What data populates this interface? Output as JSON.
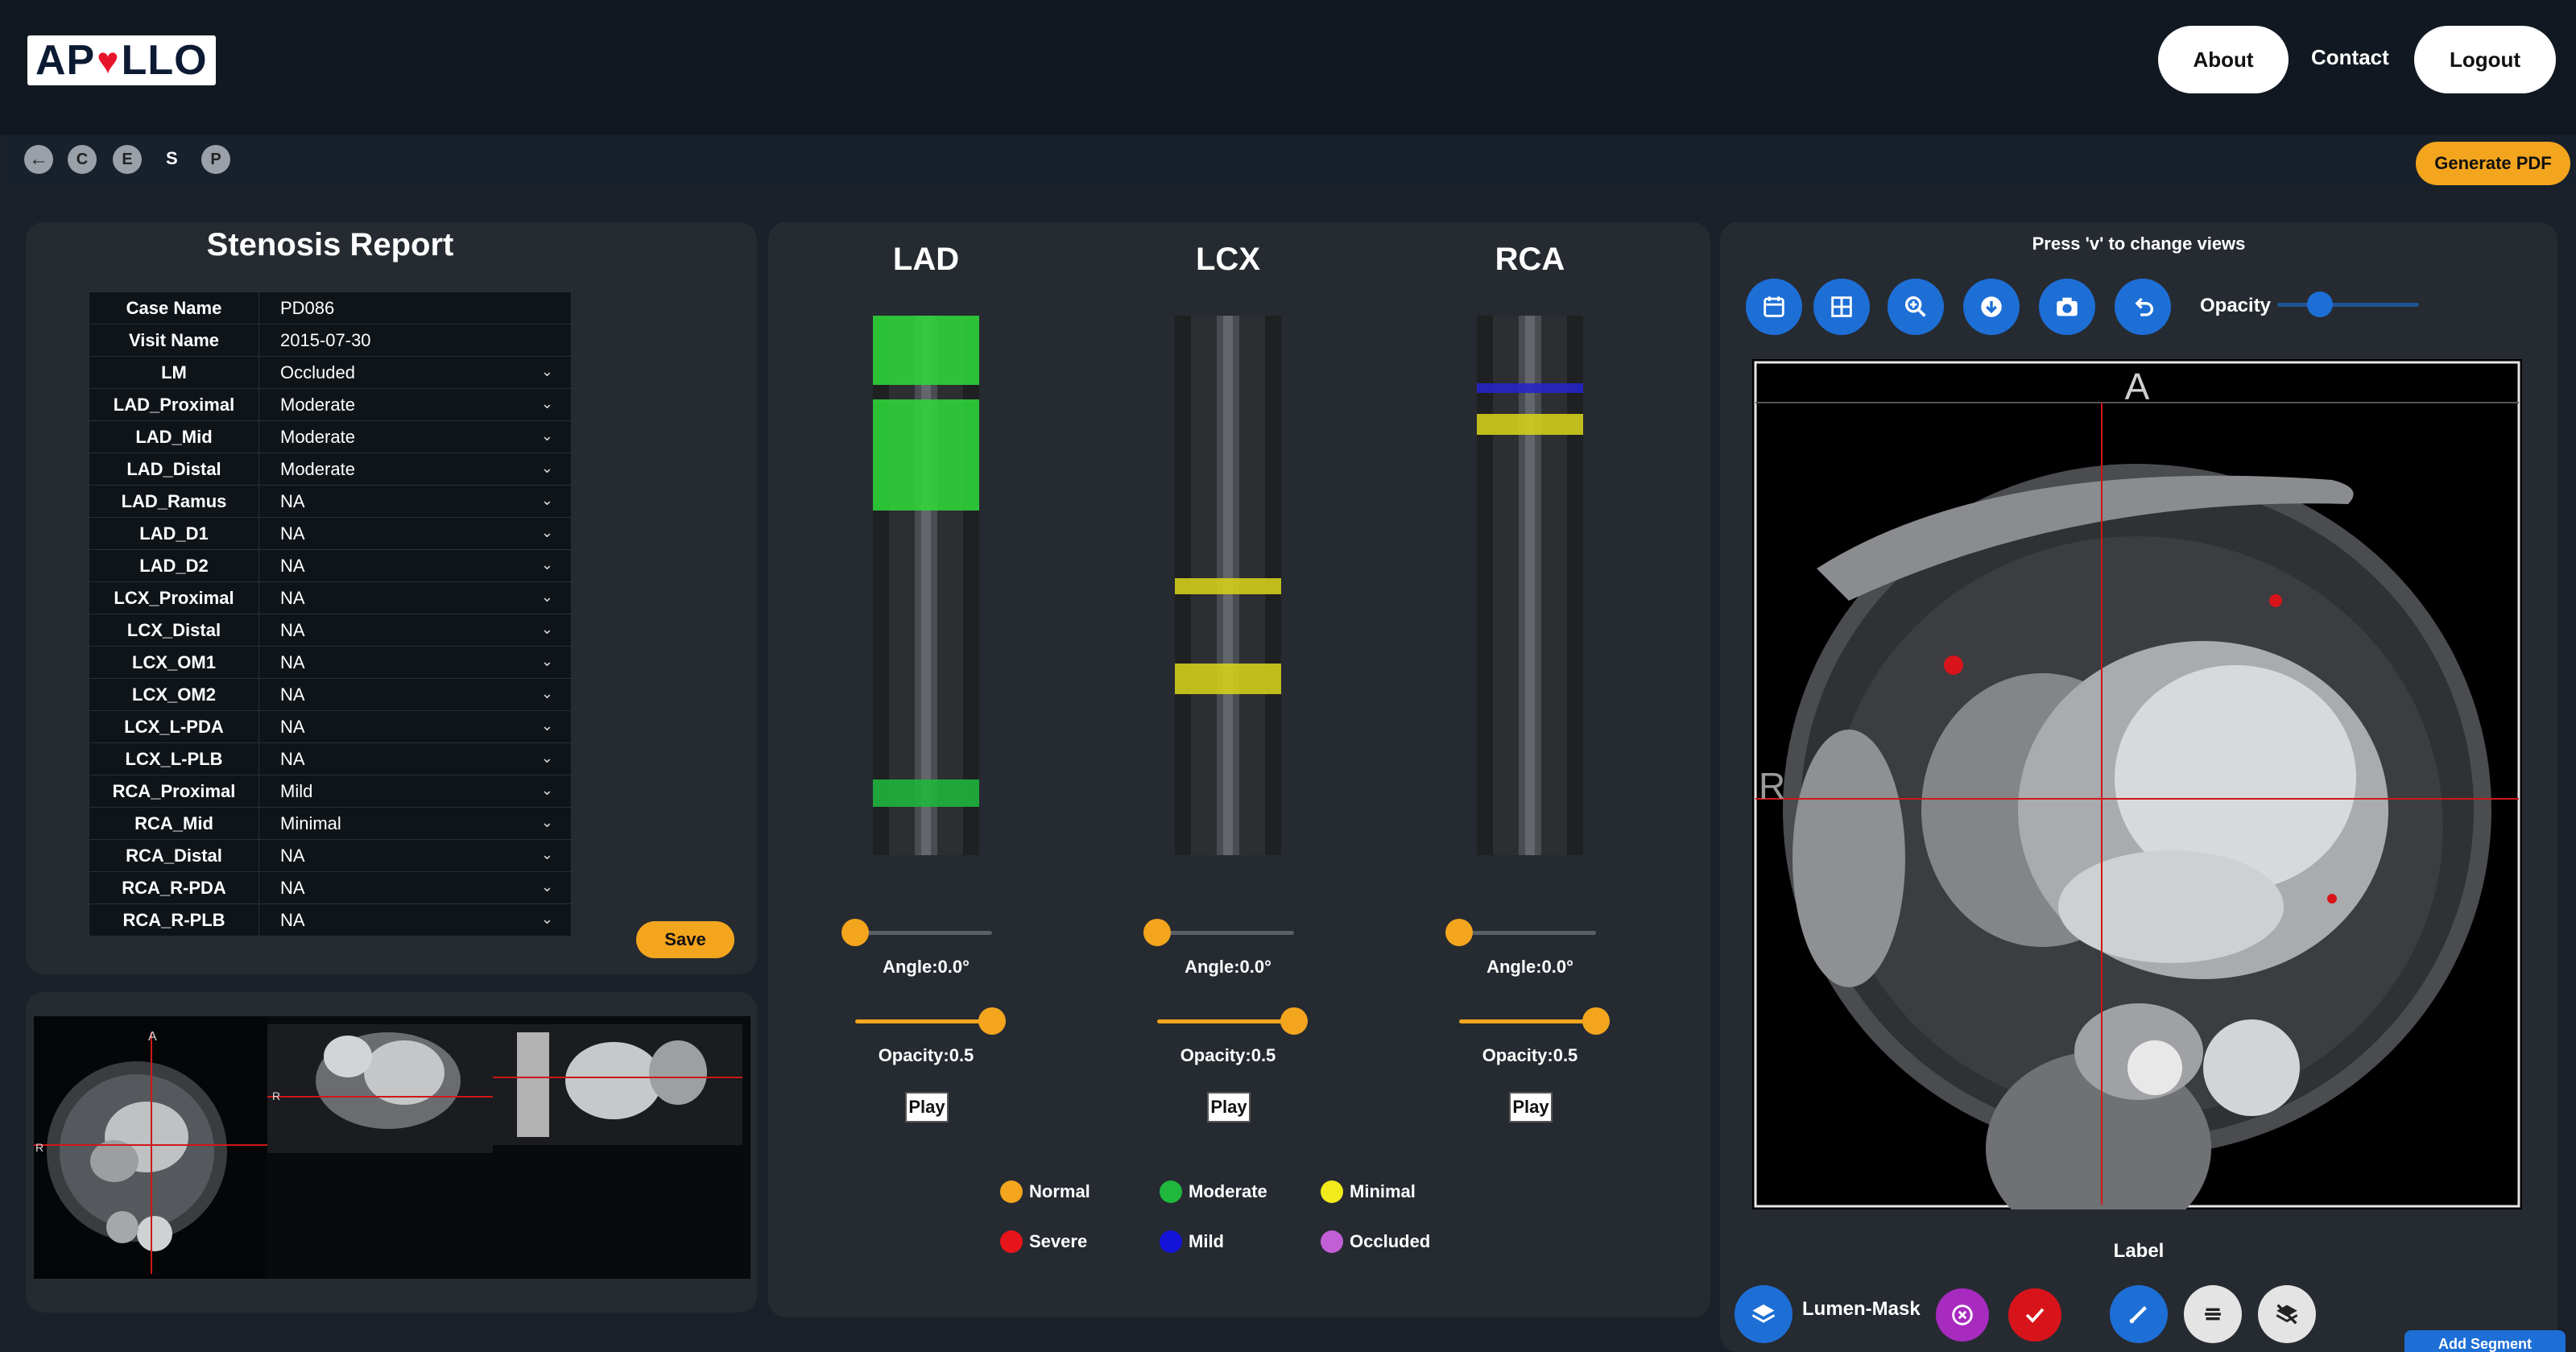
{
  "header": {
    "logo_left": "AP",
    "logo_right": "LLO",
    "about": "About",
    "contact": "Contact",
    "logout": "Logout"
  },
  "toolbar": {
    "buttons": [
      "C",
      "E",
      "S",
      "P"
    ],
    "generate_pdf": "Generate PDF"
  },
  "report": {
    "title": "Stenosis Report",
    "rows": [
      {
        "label": "Case Name",
        "value": "PD086",
        "dropdown": false
      },
      {
        "label": "Visit Name",
        "value": "2015-07-30",
        "dropdown": false
      },
      {
        "label": "LM",
        "value": "Occluded",
        "dropdown": true
      },
      {
        "label": "LAD_Proximal",
        "value": "Moderate",
        "dropdown": true
      },
      {
        "label": "LAD_Mid",
        "value": "Moderate",
        "dropdown": true
      },
      {
        "label": "LAD_Distal",
        "value": "Moderate",
        "dropdown": true
      },
      {
        "label": "LAD_Ramus",
        "value": "NA",
        "dropdown": true
      },
      {
        "label": "LAD_D1",
        "value": "NA",
        "dropdown": true
      },
      {
        "label": "LAD_D2",
        "value": "NA",
        "dropdown": true
      },
      {
        "label": "LCX_Proximal",
        "value": "NA",
        "dropdown": true
      },
      {
        "label": "LCX_Distal",
        "value": "NA",
        "dropdown": true
      },
      {
        "label": "LCX_OM1",
        "value": "NA",
        "dropdown": true
      },
      {
        "label": "LCX_OM2",
        "value": "NA",
        "dropdown": true
      },
      {
        "label": "LCX_L-PDA",
        "value": "NA",
        "dropdown": true
      },
      {
        "label": "LCX_L-PLB",
        "value": "NA",
        "dropdown": true
      },
      {
        "label": "RCA_Proximal",
        "value": "Mild",
        "dropdown": true
      },
      {
        "label": "RCA_Mid",
        "value": "Minimal",
        "dropdown": true
      },
      {
        "label": "RCA_Distal",
        "value": "NA",
        "dropdown": true
      },
      {
        "label": "RCA_R-PDA",
        "value": "NA",
        "dropdown": true
      },
      {
        "label": "RCA_R-PLB",
        "value": "NA",
        "dropdown": true
      }
    ],
    "save": "Save"
  },
  "vessels": [
    {
      "name": "LAD",
      "angle": "Angle:0.0°",
      "opacity": "Opacity:0.5",
      "angle_value": 0.0,
      "opacity_value": 0.5,
      "play": "Play"
    },
    {
      "name": "LCX",
      "angle": "Angle:0.0°",
      "opacity": "Opacity:0.5",
      "angle_value": 0.0,
      "opacity_value": 0.5,
      "play": "Play"
    },
    {
      "name": "RCA",
      "angle": "Angle:0.0°",
      "opacity": "Opacity:0.5",
      "angle_value": 0.0,
      "opacity_value": 0.5,
      "play": "Play"
    }
  ],
  "legend": [
    {
      "label": "Normal",
      "color": "#f3a51e"
    },
    {
      "label": "Moderate",
      "color": "#1fb83d"
    },
    {
      "label": "Minimal",
      "color": "#f2ea1a"
    },
    {
      "label": "Severe",
      "color": "#e8141b"
    },
    {
      "label": "Mild",
      "color": "#1414d8"
    },
    {
      "label": "Occluded",
      "color": "#c25fd6"
    }
  ],
  "viewer": {
    "hint": "Press 'v' to change views",
    "opacity_label": "Opacity",
    "opacity_value": 0.3,
    "tools": [
      "calendar-icon",
      "grid-icon",
      "zoom-icon",
      "download-icon",
      "camera-icon",
      "undo-icon"
    ],
    "orient_top": "A",
    "orient_left": "R",
    "label_heading": "Label",
    "mask_name": "Lumen-Mask",
    "add_button": "Add Segment"
  },
  "colors": {
    "accent": "#f3a51e",
    "primary": "#1d6fd6",
    "panel": "#262a31"
  }
}
